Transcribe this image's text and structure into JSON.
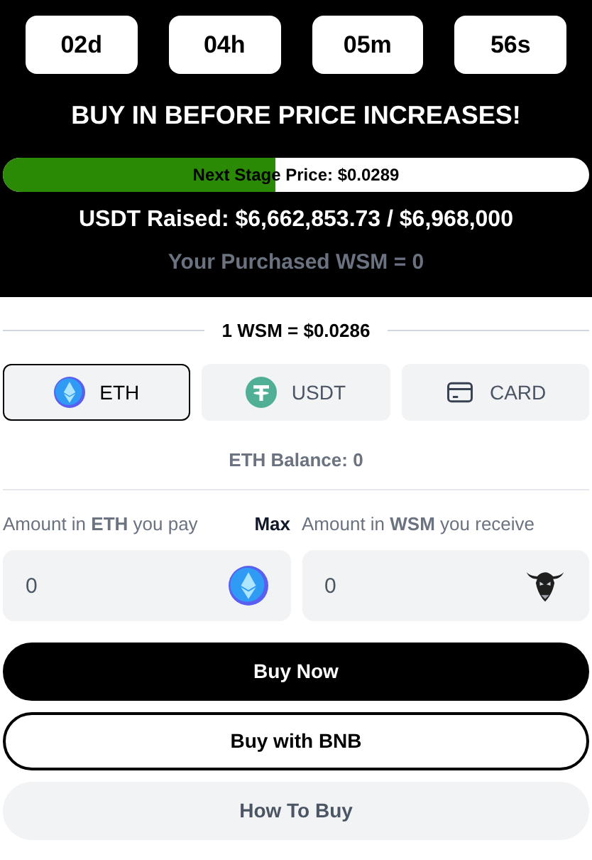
{
  "countdown": [
    {
      "value": "02d"
    },
    {
      "value": "04h"
    },
    {
      "value": "05m"
    },
    {
      "value": "56s"
    }
  ],
  "headline": "BUY IN BEFORE PRICE INCREASES!",
  "progress": {
    "level": 0.465,
    "label": "Next Stage Price: $0.0289"
  },
  "raised": "USDT Raised: $6,662,853.73 / $6,968,000",
  "purchased": "Your Purchased WSM = 0",
  "rate": "1 WSM = $0.0286",
  "tabs": [
    {
      "label": "ETH",
      "kind": "eth",
      "selected": true
    },
    {
      "label": "USDT",
      "kind": "usdt",
      "selected": false
    },
    {
      "label": "CARD",
      "kind": "card",
      "selected": false
    }
  ],
  "balance": "ETH Balance: 0",
  "pay": {
    "label": "Amount in **ETH** you pay",
    "max": "Max",
    "value": "0",
    "kind": "eth"
  },
  "receive": {
    "label": "Amount in **WSM** you receive",
    "value": "0",
    "kind": "bull"
  },
  "buttons": [
    {
      "label": "Buy Now",
      "kind": "primary"
    },
    {
      "label": "Buy with BNB",
      "kind": "outline"
    },
    {
      "label": "How To Buy",
      "kind": "secondary"
    }
  ]
}
